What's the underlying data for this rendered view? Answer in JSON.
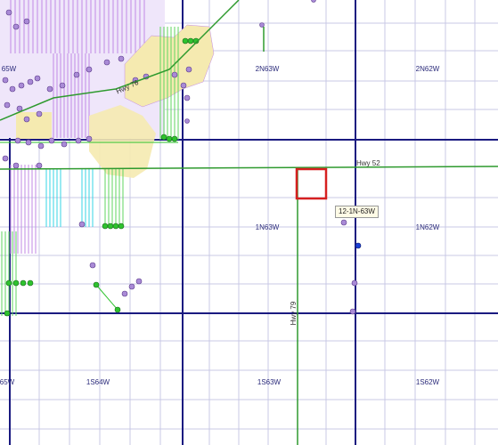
{
  "map": {
    "township_labels": [
      {
        "id": "2n63w",
        "text": "2N63W"
      },
      {
        "id": "2n62w",
        "text": "2N62W"
      },
      {
        "id": "1n63w",
        "text": "1N63W"
      },
      {
        "id": "1n62w",
        "text": "1N62W"
      },
      {
        "id": "1s64w",
        "text": "1S64W"
      },
      {
        "id": "1s63w",
        "text": "1S63W"
      },
      {
        "id": "1s62w",
        "text": "1S62W"
      },
      {
        "id": "n64w-partial",
        "text": "65W"
      },
      {
        "id": "s65w-partial",
        "text": "65W"
      }
    ],
    "highways": [
      {
        "id": "hwy-52",
        "label": "Hwy 52"
      },
      {
        "id": "hwy-79",
        "label": "Hwy 79"
      },
      {
        "id": "hwy-76",
        "label": "Hwy 76"
      }
    ],
    "selected_section": {
      "label": "12-1N-63W",
      "outline_color": "#d62020"
    },
    "colors": {
      "section_line": "#c9c9e6",
      "township_line": "#1a1a80",
      "highway": "#2e9a2e",
      "well_purple": "#a98ad6",
      "well_green": "#2ec22e",
      "well_blue": "#1a3fd6",
      "lease_purple": "#c28ae6",
      "lease_cyan": "#35d6e6",
      "lease_green": "#5fd65f",
      "urban_yellow": "#f5eab0"
    }
  }
}
